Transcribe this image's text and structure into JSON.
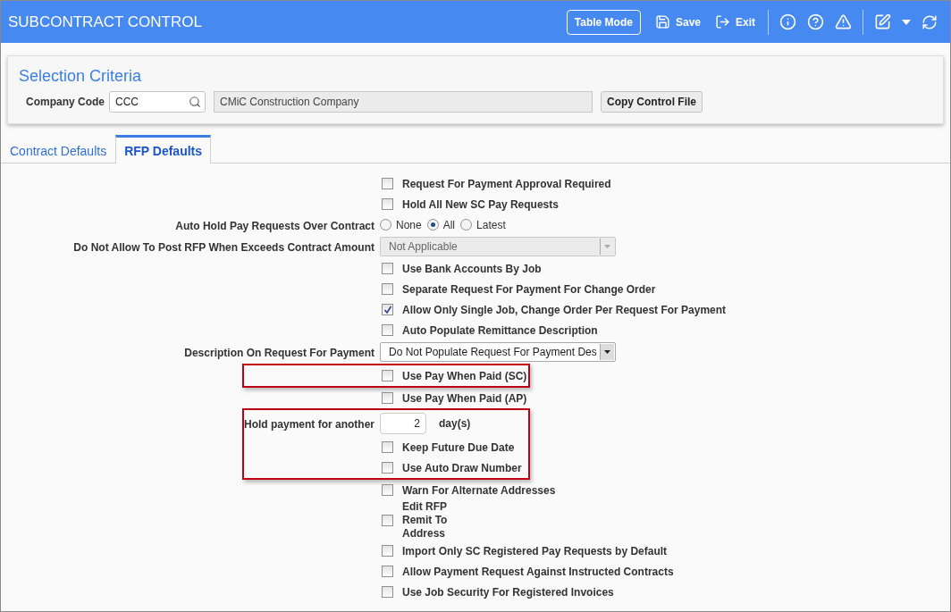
{
  "header": {
    "title": "SUBCONTRACT CONTROL",
    "buttons": [
      {
        "kind": "outlined",
        "label": "Table Mode"
      },
      {
        "kind": "save",
        "label": "Save"
      },
      {
        "kind": "exit",
        "label": "Exit"
      }
    ]
  },
  "selection": {
    "title": "Selection Criteria",
    "company_code_label": "Company Code",
    "company_code": "CCC",
    "company_name": "CMiC Construction Company",
    "copy_button": "Copy Control File"
  },
  "tabs": [
    {
      "label": "Contract Defaults",
      "selected": false
    },
    {
      "label": "RFP Defaults",
      "selected": true
    }
  ],
  "form": [
    {
      "kind": "checkbox",
      "label": "Request For Payment Approval Required",
      "checked": false
    },
    {
      "kind": "checkbox",
      "label": "Hold All New SC Pay Requests",
      "checked": false
    },
    {
      "kind": "radio",
      "label": "Auto Hold Pay Requests Over Contract",
      "options": [
        {
          "label": "None",
          "selected": false
        },
        {
          "label": "All",
          "selected": true
        },
        {
          "label": "Latest",
          "selected": false
        }
      ]
    },
    {
      "kind": "select",
      "label": "Do Not Allow To Post RFP When Exceeds Contract Amount",
      "value": "Not Applicable",
      "disabled": true
    },
    {
      "kind": "checkbox",
      "label": "Use Bank Accounts By Job",
      "checked": false
    },
    {
      "kind": "checkbox",
      "label": "Separate Request For Payment For Change Order",
      "checked": false
    },
    {
      "kind": "checkbox",
      "label": "Allow Only Single Job, Change Order Per Request For Payment",
      "checked": true
    },
    {
      "kind": "checkbox",
      "label": "Auto Populate Remittance Description",
      "checked": false
    },
    {
      "kind": "select",
      "label": "Description On Request For Payment",
      "value": "Do Not Populate Request For Payment Des",
      "disabled": false
    },
    {
      "kind": "highlight",
      "rows": [
        {
          "kind": "checkbox",
          "label": "Use Pay When Paid (SC)",
          "checked": false
        }
      ]
    },
    {
      "kind": "checkbox",
      "label": "Use Pay When Paid (AP)",
      "checked": false
    },
    {
      "kind": "highlight",
      "rows": [
        {
          "kind": "number",
          "label": "Hold payment for another",
          "value": "2",
          "suffix": "day(s)"
        },
        {
          "kind": "checkbox",
          "label": "Keep Future Due Date",
          "checked": false
        },
        {
          "kind": "checkbox",
          "label": "Use Auto Draw Number",
          "checked": false
        }
      ]
    },
    {
      "kind": "checkbox",
      "label": "Warn For Alternate Addresses",
      "checked": false
    },
    {
      "kind": "checkbox",
      "label": "Edit RFP Remit To Address",
      "checked": false,
      "narrow": true
    },
    {
      "kind": "checkbox",
      "label": "Import Only SC Registered Pay Requests by Default",
      "checked": false
    },
    {
      "kind": "checkbox",
      "label": "Allow Payment Request Against Instructed Contracts",
      "checked": false
    },
    {
      "kind": "checkbox",
      "label": "Use Job Security For Registered Invoices",
      "checked": false
    }
  ]
}
